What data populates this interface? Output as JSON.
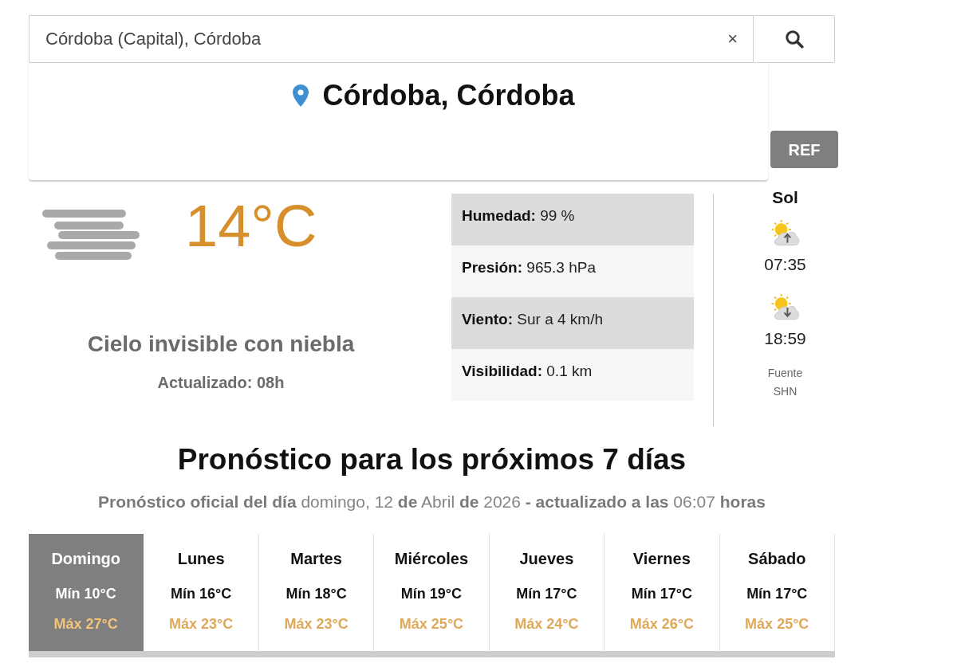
{
  "search": {
    "value": "Córdoba (Capital), Córdoba",
    "clear": "×"
  },
  "location": {
    "title": "Córdoba, Córdoba"
  },
  "ref_button": "REF",
  "current": {
    "temperature": "14°C",
    "description": "Cielo invisible con niebla",
    "updated": "Actualizado: 08h"
  },
  "details": [
    {
      "label": "Humedad:",
      "value": "99 %"
    },
    {
      "label": "Presión:",
      "value": "965.3 hPa"
    },
    {
      "label": "Viento:",
      "value": "Sur a 4 km/h"
    },
    {
      "label": "Visibilidad:",
      "value": "0.1 km"
    }
  ],
  "sun": {
    "title": "Sol",
    "events": [
      {
        "kind": "sunrise",
        "time": "07:35"
      },
      {
        "kind": "sunset",
        "time": "18:59"
      }
    ],
    "source": "Fuente SHN"
  },
  "forecast": {
    "title": "Pronóstico para los próximos 7 días",
    "subtitle": "**Pronóstico oficial del día** domingo, 12 **de** Abril **de** 2026 **- actualizado a las** 06:07 **horas**",
    "days": [
      {
        "name": "Domingo",
        "min": "Mín 10°C",
        "max": "Máx 27°C",
        "selected": true
      },
      {
        "name": "Lunes",
        "min": "Mín 16°C",
        "max": "Máx 23°C",
        "selected": false
      },
      {
        "name": "Martes",
        "min": "Mín 18°C",
        "max": "Máx 23°C",
        "selected": false
      },
      {
        "name": "Miércoles",
        "min": "Mín 19°C",
        "max": "Máx 25°C",
        "selected": false
      },
      {
        "name": "Jueves",
        "min": "Mín 17°C",
        "max": "Máx 24°C",
        "selected": false
      },
      {
        "name": "Viernes",
        "min": "Mín 17°C",
        "max": "Máx 26°C",
        "selected": false
      },
      {
        "name": "Sábado",
        "min": "Mín 17°C",
        "max": "Máx 25°C",
        "selected": false
      }
    ]
  }
}
